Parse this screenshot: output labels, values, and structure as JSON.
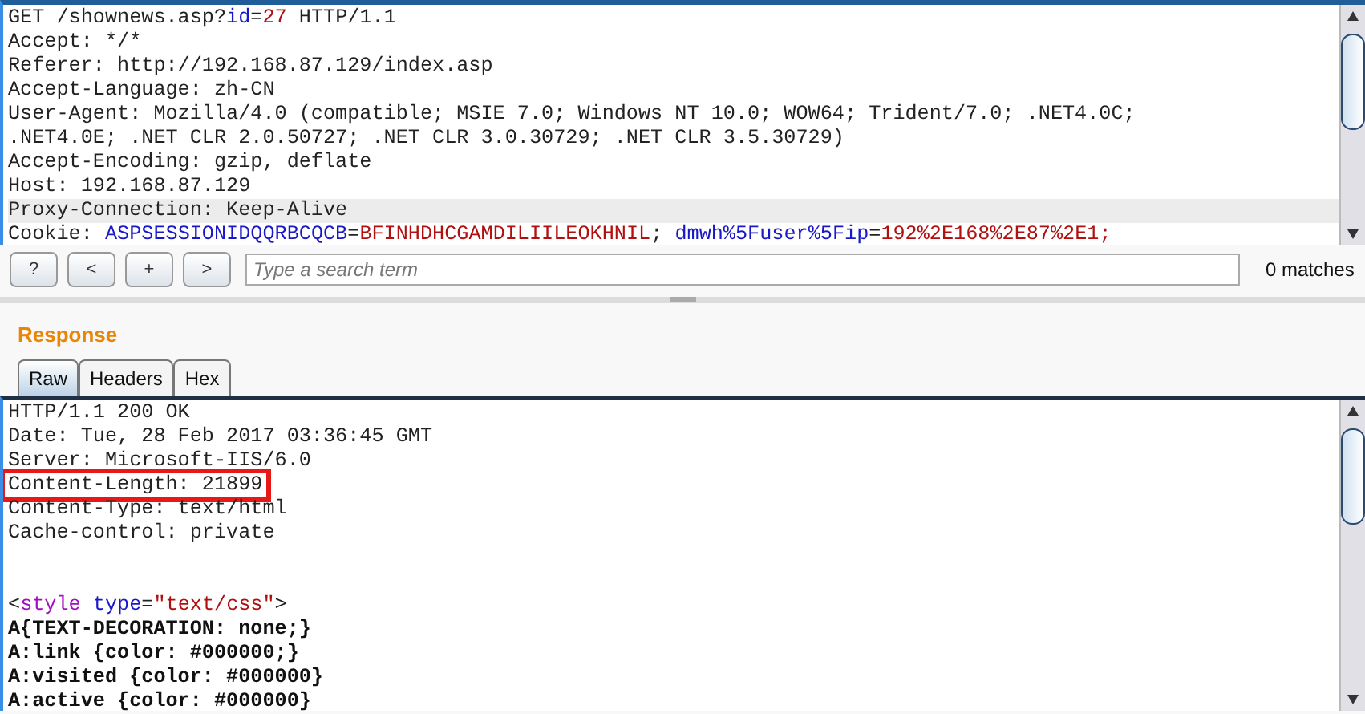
{
  "request": {
    "lines": [
      {
        "kind": "text",
        "selected": false,
        "segments": [
          {
            "text": "GET /shownews.asp?",
            "kind": "plain"
          },
          {
            "text": "id",
            "kind": "name"
          },
          {
            "text": "=",
            "kind": "plain"
          },
          {
            "text": "27",
            "kind": "value"
          },
          {
            "text": " HTTP/1.1",
            "kind": "plain"
          }
        ]
      },
      {
        "kind": "text",
        "selected": false,
        "segments": [
          {
            "text": "Accept: */*",
            "kind": "plain"
          }
        ]
      },
      {
        "kind": "text",
        "selected": false,
        "segments": [
          {
            "text": "Referer: http://192.168.87.129/index.asp",
            "kind": "plain"
          }
        ]
      },
      {
        "kind": "text",
        "selected": false,
        "segments": [
          {
            "text": "Accept-Language: zh-CN",
            "kind": "plain"
          }
        ]
      },
      {
        "kind": "text",
        "selected": false,
        "segments": [
          {
            "text": "User-Agent: Mozilla/4.0 (compatible; MSIE 7.0; Windows NT 10.0; WOW64; Trident/7.0; .NET4.0C;",
            "kind": "plain"
          }
        ]
      },
      {
        "kind": "text",
        "selected": false,
        "segments": [
          {
            "text": ".NET4.0E; .NET CLR 2.0.50727; .NET CLR 3.0.30729; .NET CLR 3.5.30729)",
            "kind": "plain"
          }
        ]
      },
      {
        "kind": "text",
        "selected": false,
        "segments": [
          {
            "text": "Accept-Encoding: gzip, deflate",
            "kind": "plain"
          }
        ]
      },
      {
        "kind": "text",
        "selected": false,
        "segments": [
          {
            "text": "Host: 192.168.87.129",
            "kind": "plain"
          }
        ]
      },
      {
        "kind": "text",
        "selected": true,
        "segments": [
          {
            "text": "Proxy-Connection: Keep-Alive",
            "kind": "plain"
          }
        ]
      },
      {
        "kind": "text",
        "selected": false,
        "segments": [
          {
            "text": "Cookie: ",
            "kind": "plain"
          },
          {
            "text": "ASPSESSIONIDQQRBCQCB",
            "kind": "name"
          },
          {
            "text": "=",
            "kind": "plain"
          },
          {
            "text": "BFINHDHCGAMDILIILEOKHNIL",
            "kind": "value"
          },
          {
            "text": "; ",
            "kind": "plain"
          },
          {
            "text": "dmwh%5Fuser%5Fip",
            "kind": "name"
          },
          {
            "text": "=",
            "kind": "plain"
          },
          {
            "text": "192%2E168%2E87%2E1;",
            "kind": "value"
          }
        ]
      }
    ]
  },
  "search": {
    "buttons": [
      "?",
      "<",
      "+",
      ">"
    ],
    "placeholder": "Type a search term",
    "matches": "0 matches"
  },
  "response": {
    "title": "Response",
    "tabs": [
      {
        "label": "Raw",
        "selected": true
      },
      {
        "label": "Headers",
        "selected": false
      },
      {
        "label": "Hex",
        "selected": false
      }
    ],
    "lines": [
      {
        "kind": "text",
        "boxed": false,
        "segments": [
          {
            "text": "HTTP/1.1 200 OK",
            "kind": "plain"
          }
        ]
      },
      {
        "kind": "text",
        "boxed": false,
        "segments": [
          {
            "text": "Date: Tue, 28 Feb 2017 03:36:45 GMT",
            "kind": "plain"
          }
        ]
      },
      {
        "kind": "text",
        "boxed": false,
        "segments": [
          {
            "text": "Server: Microsoft-IIS/6.0",
            "kind": "plain"
          }
        ]
      },
      {
        "kind": "text",
        "boxed": true,
        "segments": [
          {
            "text": "Content-Length: 21899",
            "kind": "plain"
          }
        ]
      },
      {
        "kind": "text",
        "boxed": false,
        "segments": [
          {
            "text": "Content-Type: text/html",
            "kind": "plain"
          }
        ]
      },
      {
        "kind": "text",
        "boxed": false,
        "segments": [
          {
            "text": "Cache-control: private",
            "kind": "plain"
          }
        ]
      },
      {
        "kind": "blank"
      },
      {
        "kind": "blank"
      },
      {
        "kind": "text",
        "boxed": false,
        "segments": [
          {
            "text": "<",
            "kind": "plain"
          },
          {
            "text": "style",
            "kind": "tag"
          },
          {
            "text": " type",
            "kind": "name"
          },
          {
            "text": "=",
            "kind": "plain"
          },
          {
            "text": "\"text/css\"",
            "kind": "value"
          },
          {
            "text": ">",
            "kind": "plain"
          }
        ]
      },
      {
        "kind": "text",
        "boxed": false,
        "segments": [
          {
            "text": "A{TEXT-DECORATION: none;}",
            "kind": "bold"
          }
        ]
      },
      {
        "kind": "text",
        "boxed": false,
        "segments": [
          {
            "text": "A:link {color: #000000;}",
            "kind": "bold"
          }
        ]
      },
      {
        "kind": "text",
        "boxed": false,
        "segments": [
          {
            "text": "A:visited {color: #000000}",
            "kind": "bold"
          }
        ]
      },
      {
        "kind": "text",
        "boxed": false,
        "segments": [
          {
            "text": "A:active {color: #000000}",
            "kind": "bold"
          }
        ]
      }
    ]
  }
}
